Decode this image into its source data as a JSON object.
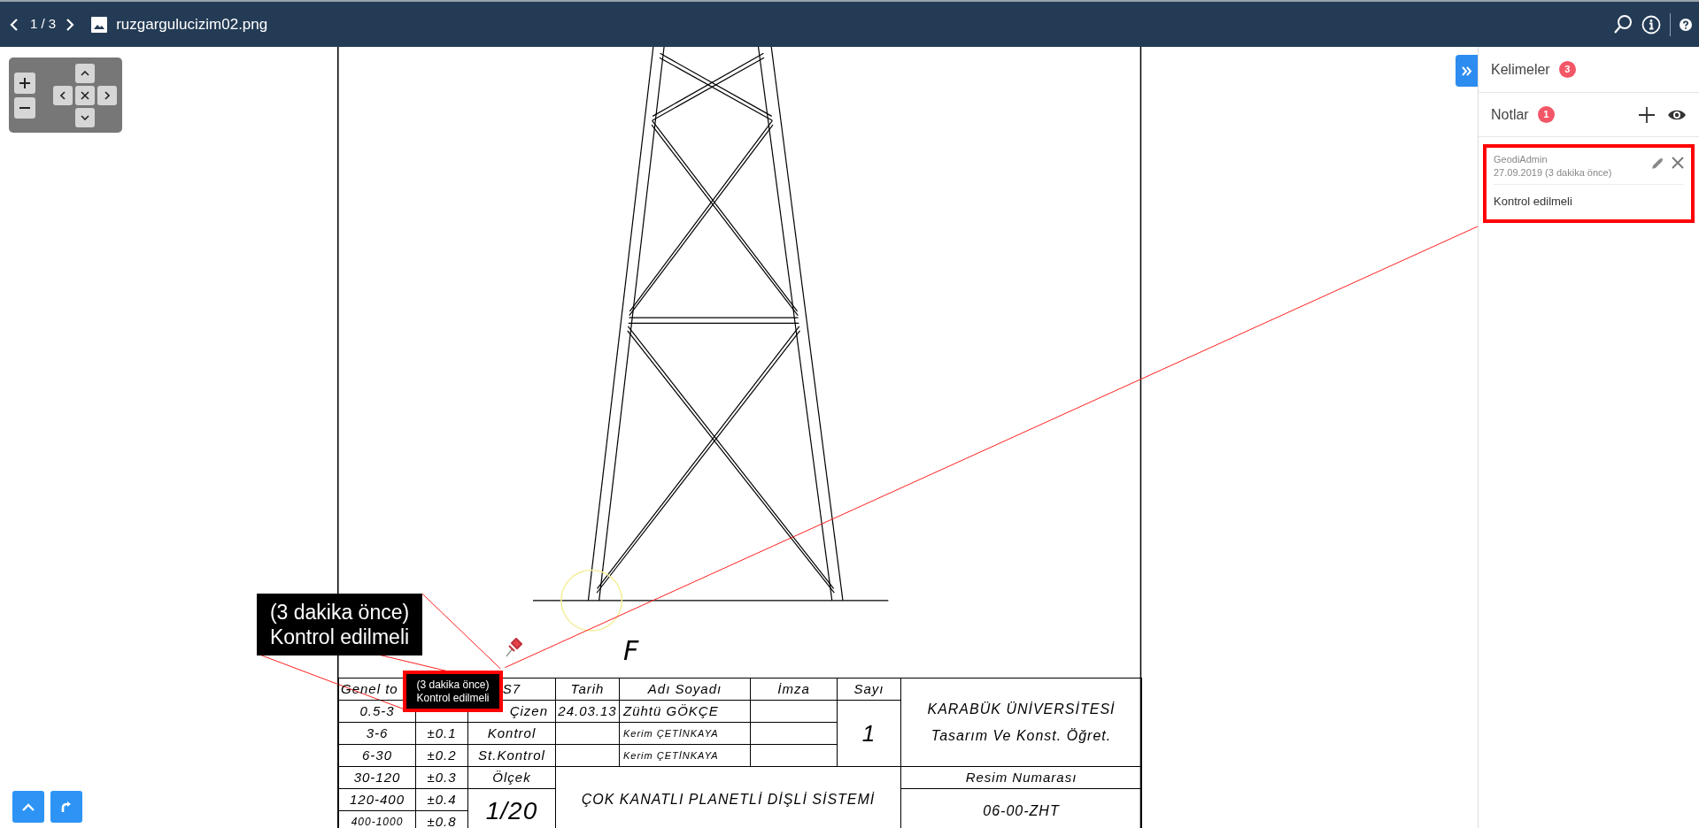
{
  "top_bar": {
    "page_counter": "1 / 3",
    "file_name": "ruzgargulucizim02.png"
  },
  "drawing": {
    "view_label": "F",
    "title_block": {
      "tolerance_header": "Genel to",
      "standard_header": "S7",
      "date_header": "Tarih",
      "name_header": "Adı Soyadı",
      "signature_header": "İmza",
      "count_header": "Sayı",
      "count": "1",
      "tolerances": [
        {
          "range": "0.5-3"
        },
        {
          "range": "3-6",
          "tolerance": "±0.1"
        },
        {
          "range": "6-30",
          "tolerance": "±0.2"
        },
        {
          "range": "30-120",
          "tolerance": "±0.3"
        },
        {
          "range": "120-400",
          "tolerance": "±0.4"
        },
        {
          "range": "400-1000",
          "tolerance": "±0.8"
        }
      ],
      "roles": [
        {
          "role": "Çizen",
          "date": "24.03.13",
          "name": "Zühtü GÖKÇE"
        },
        {
          "role": "Kontrol",
          "name": "Kerim ÇETİNKAYA"
        },
        {
          "role": "St.Kontrol",
          "name": "Kerim ÇETİNKAYA"
        }
      ],
      "scale_label": "Ölçek",
      "scale": "1/20",
      "drawing_title": "ÇOK KANATLI PLANETLİ DİŞLİ SİSTEMİ",
      "institution": "KARABÜK ÜNİVERSİTESİ",
      "department": "Tasarım Ve Konst. Öğret.",
      "drawing_number_label": "Resim Numarası",
      "drawing_number": "06-00-ZHT"
    },
    "note_popup": {
      "time": "(3 dakika önce)",
      "text": "Kontrol edilmeli"
    },
    "note_label": {
      "time": "(3 dakika önce)",
      "text": "Kontrol edilmeli"
    }
  },
  "sidebar": {
    "words": {
      "label": "Kelimeler",
      "count": "3"
    },
    "notes": {
      "label": "Notlar",
      "count": "1",
      "items": [
        {
          "author": "GeodiAdmin",
          "date": "27.09.2019 (3 dakika önce)",
          "text": "Kontrol edilmeli",
          "selected": true
        }
      ]
    }
  }
}
